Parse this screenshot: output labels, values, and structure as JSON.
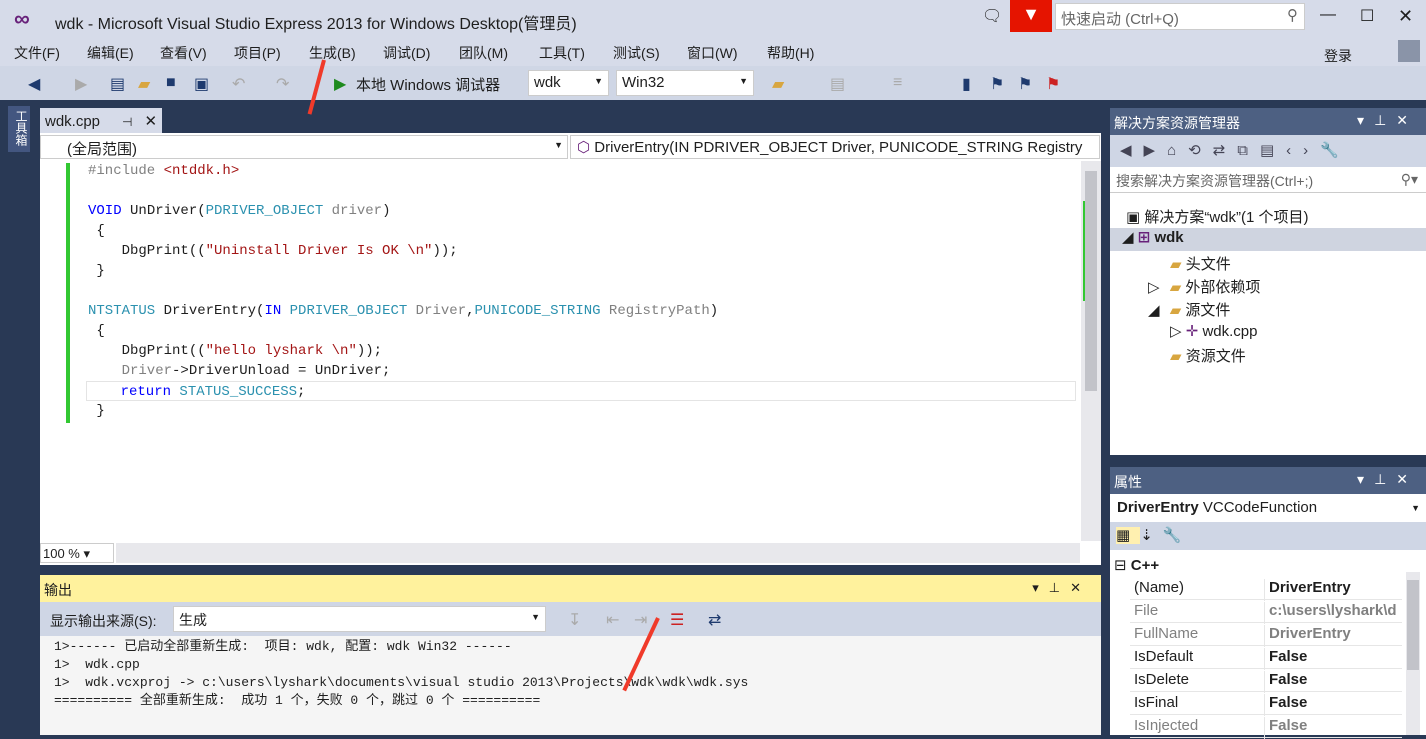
{
  "window": {
    "title": "wdk - Microsoft Visual Studio Express 2013 for Windows Desktop(管理员)",
    "quick_launch": "快速启动 (Ctrl+Q)",
    "login": "登录"
  },
  "menu": [
    "文件(F)",
    "编辑(E)",
    "查看(V)",
    "项目(P)",
    "生成(B)",
    "调试(D)",
    "团队(M)",
    "工具(T)",
    "测试(S)",
    "窗口(W)",
    "帮助(H)"
  ],
  "toolbar": {
    "debugger": "本地 Windows 调试器",
    "config": "wdk",
    "platform": "Win32"
  },
  "toolbox": "工具箱",
  "editor": {
    "tab": "wdk.cpp",
    "scope": "(全局范围)",
    "member": "DriverEntry(IN PDRIVER_OBJECT Driver, PUNICODE_STRING Registry",
    "zoom": "100 %",
    "lines": {
      "l1a": "#include ",
      "l1b": "<ntddk.h>",
      "l3a": "VOID",
      " l3b": " UnDriver(",
      "l3c": "PDRIVER_OBJECT",
      "l3d": " driver",
      "l3e": ")",
      "l4": " {",
      "l5a": "    DbgPrint((",
      "l5b": "\"Uninstall Driver Is OK \\n\"",
      "l5c": "));",
      "l6": " }",
      "l8a": "NTSTATUS",
      " l8b": " DriverEntry(",
      "l8c": "IN",
      "l8d": " PDRIVER_OBJECT",
      "l8e": " Driver",
      ",": ",",
      "l8f": "PUNICODE_STRING",
      "l8g": " RegistryPath",
      "l8h": ")",
      "l9": " {",
      "l10a": "    DbgPrint((",
      "l10b": "\"hello lyshark \\n\"",
      "l10c": "));",
      "l11a": "    Driver",
      "l11b": "->DriverUnload = UnDriver;",
      "l12a": "    return ",
      "l12b": "STATUS_SUCCESS",
      ";": ";",
      "l13": " }"
    }
  },
  "output": {
    "title": "输出",
    "source_label": "显示输出来源(S):",
    "source": "生成",
    "lines": [
      "1>------ 已启动全部重新生成:  项目: wdk, 配置: wdk Win32 ------",
      "1>  wdk.cpp",
      "1>  wdk.vcxproj -> c:\\users\\lyshark\\documents\\visual studio 2013\\Projects\\wdk\\wdk\\wdk.sys",
      "========== 全部重新生成:  成功 1 个，失败 0 个，跳过 0 个 =========="
    ]
  },
  "solution": {
    "title": "解决方案资源管理器",
    "search": "搜索解决方案资源管理器(Ctrl+;)",
    "items": [
      "解决方案“wdk”(1 个项目)",
      "wdk",
      "头文件",
      "外部依赖项",
      "源文件",
      "wdk.cpp",
      "资源文件"
    ]
  },
  "properties": {
    "title": "属性",
    "object": "DriverEntry",
    "type": "VCCodeFunction",
    "category": "C++",
    "rows": [
      {
        "k": "(Name)",
        "v": "DriverEntry"
      },
      {
        "k": "File",
        "v": "c:\\users\\lyshark\\d"
      },
      {
        "k": "FullName",
        "v": "DriverEntry"
      },
      {
        "k": "IsDefault",
        "v": "False"
      },
      {
        "k": "IsDelete",
        "v": "False"
      },
      {
        "k": "IsFinal",
        "v": "False"
      },
      {
        "k": "IsInjected",
        "v": "False"
      }
    ]
  }
}
